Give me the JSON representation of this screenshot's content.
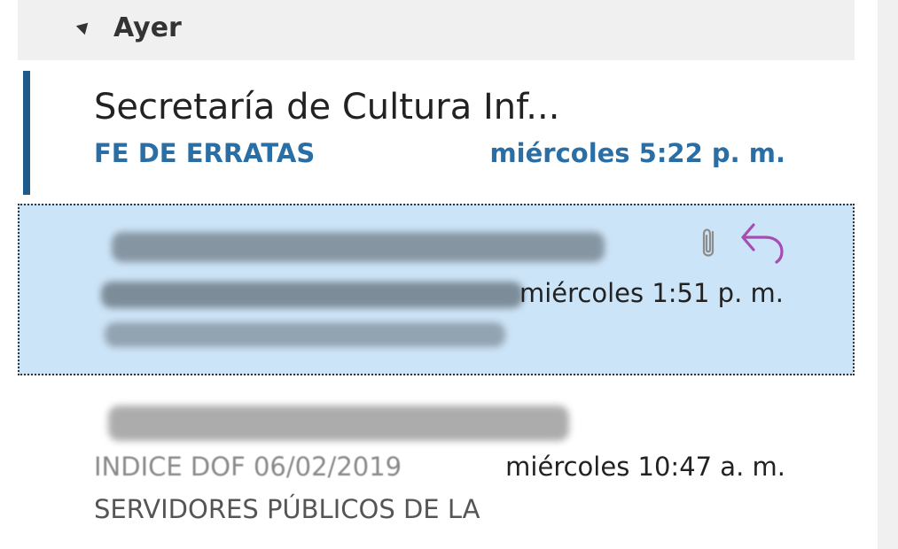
{
  "group": {
    "label": "Ayer"
  },
  "items": [
    {
      "sender": "Secretaría de Cultura Inf...",
      "subject": "FE DE ERRATAS",
      "time": "miércoles 5:22 p. m.",
      "unread": true
    },
    {
      "sender": "",
      "subject": "",
      "time": "miércoles 1:51 p. m.",
      "has_attachment": true,
      "replied": true,
      "selected": true
    },
    {
      "sender": "",
      "subject": "INDICE DOF 06/02/2019",
      "time": "miércoles 10:47 a. m.",
      "preview": "SERVIDORES PÚBLICOS DE LA"
    }
  ],
  "colors": {
    "accent": "#1e5a8a",
    "unread_text": "#2a6ea6",
    "selected_bg": "#cce4f7",
    "reply_icon": "#a64db3"
  }
}
